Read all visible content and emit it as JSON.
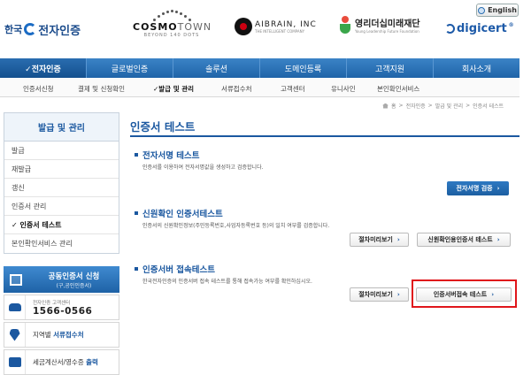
{
  "header": {
    "language_button": "English",
    "logos": {
      "kica": {
        "kor": "한국",
        "name": "전자인증"
      },
      "cosmotown": {
        "main": "COSMO",
        "accent": "TOWN",
        "sub": "BEYOND 140 DOTS"
      },
      "aibrain": {
        "name": "AIBRAIN, INC",
        "sub": "THE INTELLIGENT COMPANY"
      },
      "foundation": {
        "name": "영리더십미래재단",
        "sub": "Young Leadership Future Foundation"
      },
      "digicert": {
        "name": "digicert",
        "reg": "®"
      }
    }
  },
  "main_nav": {
    "items": [
      "✓전자인증",
      "글로벌인증",
      "솔루션",
      "도메인등록",
      "고객지원",
      "회사소개"
    ]
  },
  "sub_nav": {
    "items": [
      "인증서신청",
      "결제 및 신청확인",
      "✓발급 및 관리",
      "서류접수처",
      "고객센터",
      "유니사인",
      "본인확인서비스"
    ]
  },
  "breadcrumb": {
    "items": [
      "홈",
      "전자인증",
      "발급 및 관리",
      "인증서 테스트"
    ],
    "separator": ">"
  },
  "sidebar": {
    "title": "발급 및 관리",
    "items": [
      "발급",
      "재발급",
      "갱신",
      "인증서 관리",
      "✓ 인증서 테스트",
      "본인확인서비스 관리"
    ],
    "active_index": 4,
    "apply": {
      "main": "공동인증서 신청",
      "sub": "(구,공인인증서)"
    },
    "tel": {
      "label": "전자인증 고객센터",
      "number": "1566-0566"
    },
    "reception": {
      "prefix": "지역별 ",
      "highlight": "서류접수처"
    },
    "tax": {
      "prefix": "세금계산서/영수증 ",
      "highlight": "출력"
    }
  },
  "content": {
    "title": "인증서 테스트",
    "sections": [
      {
        "title": "전자서명 테스트",
        "desc": "인증서를 이용하여 전자서명값을 생성하고 검증합니다.",
        "buttons": [
          "전자서명 검증"
        ]
      },
      {
        "title": "신원확인 인증서테스트",
        "desc": "인증서의 신원확인정보(주민등록번호,사업자등록번호 등)의 일치 여부를 검증합니다.",
        "buttons": [
          "절차미리보기",
          "신원확인용인증서 테스트"
        ]
      },
      {
        "title": "인증서버 접속테스트",
        "desc": "한국전자인증의 인증서버 접속 테스트를 통해 접속가능 여부를 확인하십시오.",
        "buttons": [
          "절차미리보기",
          "인증서버접속 테스트"
        ]
      }
    ],
    "arrow": "›"
  },
  "colors": {
    "brand_blue": "#1b58a0",
    "nav_blue": "#2a6db0",
    "highlight_red": "#e0161b"
  }
}
